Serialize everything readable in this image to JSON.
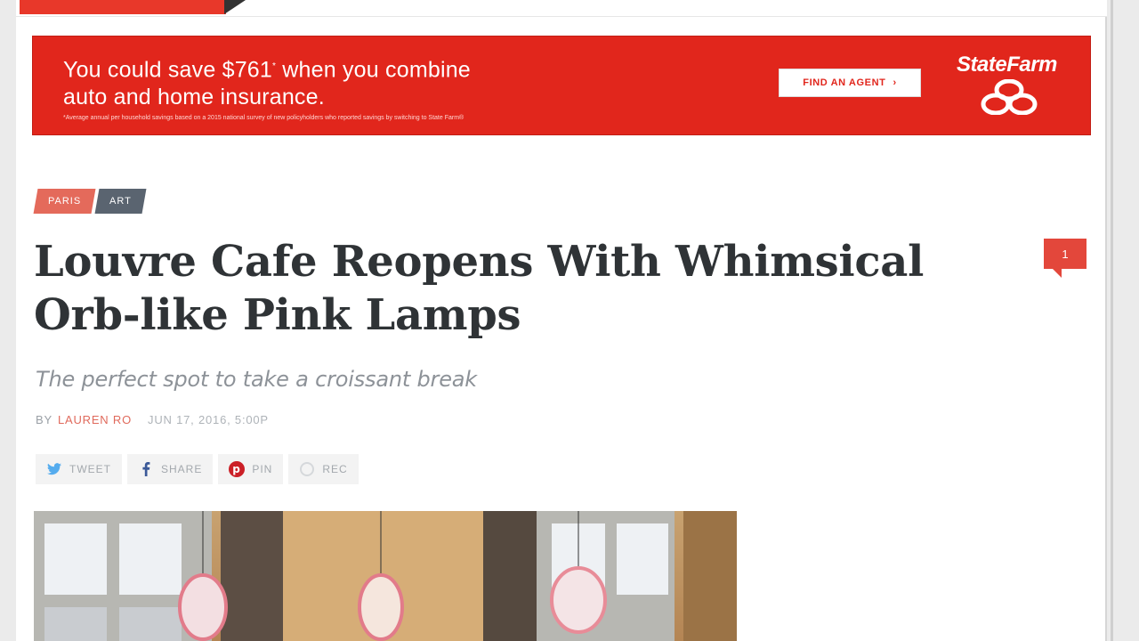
{
  "ad": {
    "line1_a": "You could save $761",
    "line1_sup": "*",
    "line1_b": " when you combine",
    "line2": "auto and home insurance.",
    "fine_print": "*Average annual per household savings based on a 2015 national survey of new policyholders who reported savings by switching to State Farm®",
    "button": "FIND AN AGENT",
    "brand": "StateFarm",
    "colors": {
      "brand_red": "#e1261c"
    }
  },
  "tags": [
    "PARIS",
    "ART"
  ],
  "headline": "Louvre Cafe Reopens With Whimsical Orb-like Pink Lamps",
  "comment_count": "1",
  "dek": "The perfect spot to take a croissant break",
  "byline": {
    "prefix": "BY",
    "author": "LAUREN RO",
    "date": "JUN 17, 2016, 5:00P"
  },
  "share": [
    {
      "label": "TWEET",
      "icon": "twitter-icon"
    },
    {
      "label": "SHARE",
      "icon": "facebook-icon"
    },
    {
      "label": "PIN",
      "icon": "pinterest-icon"
    },
    {
      "label": "REC",
      "icon": "recommend-icon"
    }
  ]
}
